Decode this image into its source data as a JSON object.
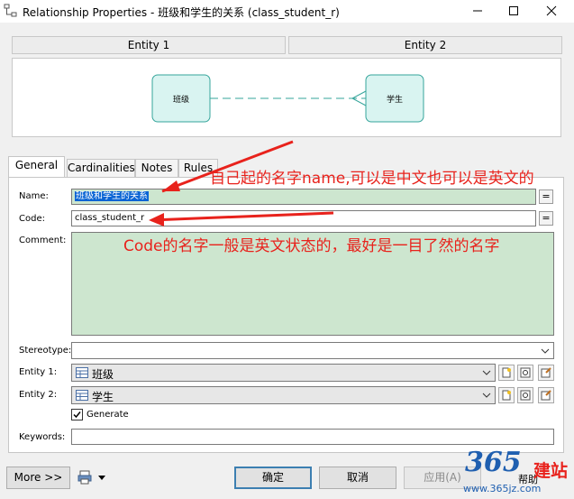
{
  "window": {
    "title": "Relationship Properties - 班级和学生的关系 (class_student_r)"
  },
  "entities_header": {
    "entity1": "Entity 1",
    "entity2": "Entity 2"
  },
  "diagram": {
    "left_entity": "班级",
    "right_entity": "学生"
  },
  "tabs": [
    "General",
    "Cardinalities",
    "Notes",
    "Rules"
  ],
  "form": {
    "name_label": "Name:",
    "name_value": "班级和学生的关系",
    "code_label": "Code:",
    "code_value": "class_student_r",
    "comment_label": "Comment:",
    "stereotype_label": "Stereotype:",
    "entity1_label": "Entity 1:",
    "entity1_value": "班级",
    "entity2_label": "Entity 2:",
    "entity2_value": "学生",
    "generate_label": "Generate",
    "generate_checked": true,
    "keywords_label": "Keywords:",
    "eq_symbol": "="
  },
  "buttons": {
    "more": "More >>",
    "ok": "确定",
    "cancel": "取消",
    "apply": "应用(A)",
    "help": "帮助"
  },
  "annotations": {
    "name_note": "自己起的名字name,可以是中文也可以是英文的",
    "code_note": "Code的名字一般是英文状态的，最好是一目了然的名字"
  },
  "watermark": {
    "brand": "365",
    "site_cn": "建站",
    "url": "www.365jz.com"
  },
  "colors": {
    "annotation": "#e8221c",
    "entity_fill": "#d9f4f1",
    "entity_border": "#35a59b",
    "comment_bg": "#cde6cf",
    "selection": "#0a64d4"
  }
}
